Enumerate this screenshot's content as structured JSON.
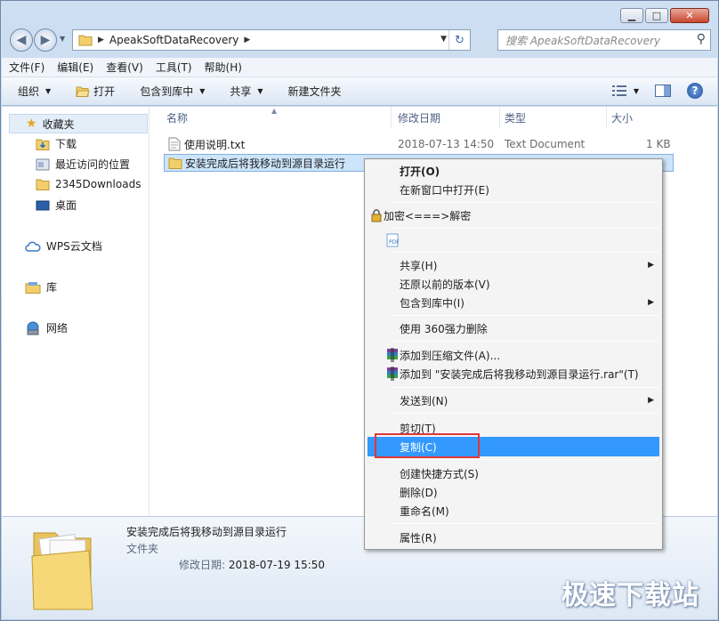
{
  "window": {
    "caption": {
      "minimize": "▁",
      "maximize": "□",
      "close": "✕"
    }
  },
  "address": {
    "crumb": "ApeakSoftDataRecovery",
    "search_placeholder": "搜索 ApeakSoftDataRecovery"
  },
  "menubar": [
    "文件(F)",
    "编辑(E)",
    "查看(V)",
    "工具(T)",
    "帮助(H)"
  ],
  "toolbar": {
    "organize": "组织",
    "open": "打开",
    "include_library": "包含到库中",
    "share": "共享",
    "new_folder": "新建文件夹"
  },
  "nav": {
    "favorites": "收藏夹",
    "downloads": "下载",
    "recent": "最近访问的位置",
    "d2345": "2345Downloads",
    "desktop": "桌面",
    "wps": "WPS云文档",
    "libraries": "库",
    "network": "网络"
  },
  "columns": {
    "name": "名称",
    "date": "修改日期",
    "type": "类型",
    "size": "大小"
  },
  "files": [
    {
      "name": "使用说明.txt",
      "date": "2018-07-13 14:50",
      "type": "Text Document",
      "size": "1 KB",
      "icon": "text-file-icon"
    },
    {
      "name": "安装完成后将我移动到源目录运行",
      "date": "",
      "type": "",
      "size": "",
      "icon": "folder-icon"
    }
  ],
  "context_menu": {
    "open": "打开(O)",
    "open_new_window": "在新窗口中打开(E)",
    "encrypt": "加密<===>解密",
    "share": "共享(H)",
    "restore": "还原以前的版本(V)",
    "include_library": "包含到库中(I)",
    "delete_360": "使用 360强力删除",
    "add_archive": "添加到压缩文件(A)...",
    "add_rar": "添加到 \"安装完成后将我移动到源目录运行.rar\"(T)",
    "send_to": "发送到(N)",
    "cut": "剪切(T)",
    "copy": "复制(C)",
    "create_shortcut": "创建快捷方式(S)",
    "delete": "删除(D)",
    "rename": "重命名(M)",
    "properties": "属性(R)"
  },
  "details": {
    "name": "安装完成后将我移动到源目录运行",
    "type": "文件夹",
    "modified_label": "修改日期:",
    "modified_value": "2018-07-19 15:50"
  },
  "watermark": "极速下载站",
  "colors": {
    "highlight": "#3399ff",
    "annotation": "#e0363a",
    "selection": "#cde5fb"
  }
}
